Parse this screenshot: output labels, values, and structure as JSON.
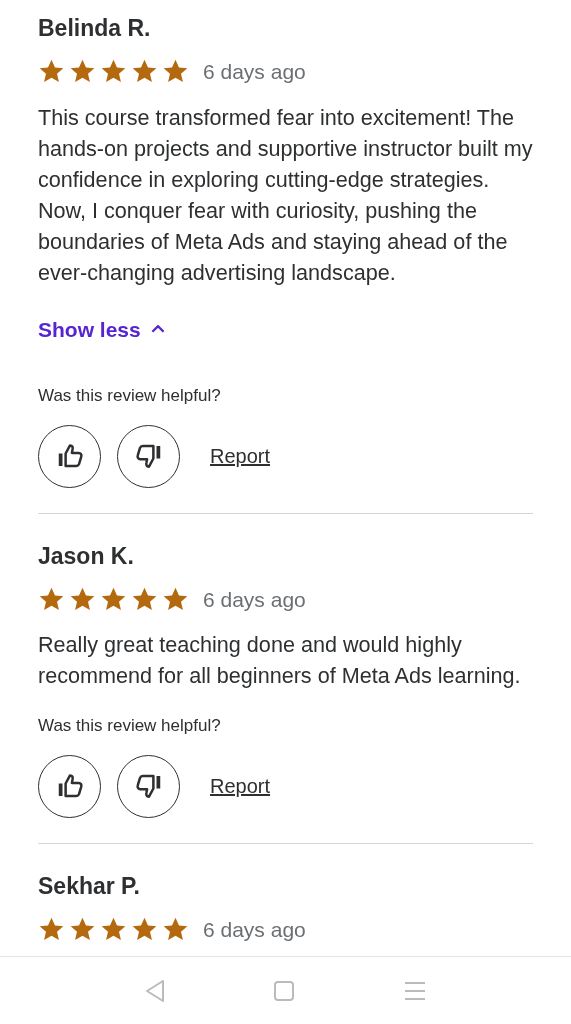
{
  "reviews": [
    {
      "name": "Belinda R.",
      "stars": 5,
      "date": "6 days ago",
      "text": "This course transformed fear into excitement! The hands-on projects and supportive instructor built my confidence in exploring cutting-edge strategies. Now, I conquer fear with curiosity, pushing the boundaries of Meta Ads and staying ahead of the ever-changing advertising landscape.",
      "toggle": {
        "label": "Show less",
        "expanded": true
      },
      "helpful_prompt": "Was this review helpful?",
      "report": "Report"
    },
    {
      "name": "Jason K.",
      "stars": 5,
      "date": "6 days ago",
      "text": "Really great teaching done and would highly recommend for all beginners of Meta Ads learning.",
      "helpful_prompt": "Was this review helpful?",
      "report": "Report"
    },
    {
      "name": "Sekhar P.",
      "stars": 5,
      "date": "6 days ago"
    }
  ]
}
